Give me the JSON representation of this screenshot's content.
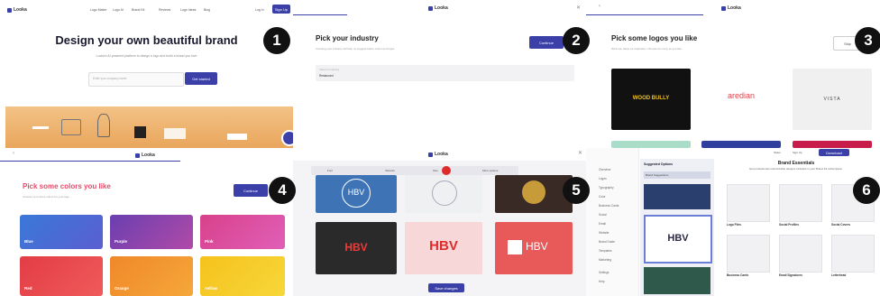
{
  "step_badges": [
    "1",
    "2",
    "3",
    "4",
    "5",
    "6"
  ],
  "brand": {
    "name": "Looka"
  },
  "step1": {
    "nav": [
      "Logo Maker",
      "Logo AI",
      "Brand Kit",
      "Reviews",
      "Logo Ideas",
      "Blog"
    ],
    "login": "Log in",
    "cta_top": "Sign Up",
    "headline": "Design your own beautiful brand",
    "subtext": "Looka's AI-powered platform to design a logo and build a brand you love",
    "input_placeholder": "Enter your company name",
    "start_button": "Get started"
  },
  "step2": {
    "title": "Pick your industry",
    "subtitle": "Knowing your industry will help us suggest better colors and logos",
    "continue_button": "Continue",
    "field_label": "Select an industry",
    "field_value": "Restaurant"
  },
  "step3": {
    "title": "Pick some logos you like",
    "subtitle": "We'll use these as inspiration. Choose as many as you like.",
    "skip_button": "Skip",
    "logos": [
      "WOOD BULLY",
      "aredian",
      "VISTA"
    ]
  },
  "step4": {
    "title": "Pick some colors you like",
    "subtitle": "Choose up to three colors for your logo",
    "continue_button": "Continue",
    "colors": [
      {
        "name": "Blue",
        "c1": "#3a78d8",
        "c2": "#5a5fd0"
      },
      {
        "name": "Purple",
        "c1": "#6a3fb0",
        "c2": "#b04aa8"
      },
      {
        "name": "Pink",
        "c1": "#d8418a",
        "c2": "#e05fb8"
      },
      {
        "name": "Red",
        "c1": "#e23d45",
        "c2": "#f05a5a"
      },
      {
        "name": "Orange",
        "c1": "#f0882a",
        "c2": "#f5a73a"
      },
      {
        "name": "Yellow",
        "c1": "#f5c21c",
        "c2": "#f7d73a"
      }
    ]
  },
  "step5": {
    "toolbar": [
      "Font",
      "Variants",
      "Size",
      "More options"
    ],
    "monogram": "HBV",
    "wordmark": "HBV",
    "bottom_button": "Save changes"
  },
  "step6": {
    "title": "Brand Essentials",
    "subtitle": "Get professional customizable designs included in your Brand Kit subscription",
    "buttons": [
      "Share",
      "Sign Up",
      "Download"
    ],
    "sidebar": [
      "Overview",
      "Logos",
      "Typography",
      "Color",
      "Business Cards",
      "Social",
      "Email",
      "Website",
      "Brand Guide",
      "Templates",
      "Marketing",
      "Settings",
      "Help"
    ],
    "panel_title": "Suggested Options",
    "panel_tab": "Brand Suggestions",
    "cards": [
      "Logo Files",
      "Social Profiles",
      "Social Covers",
      "Business Cards",
      "Email Signatures",
      "Letterhead"
    ]
  }
}
